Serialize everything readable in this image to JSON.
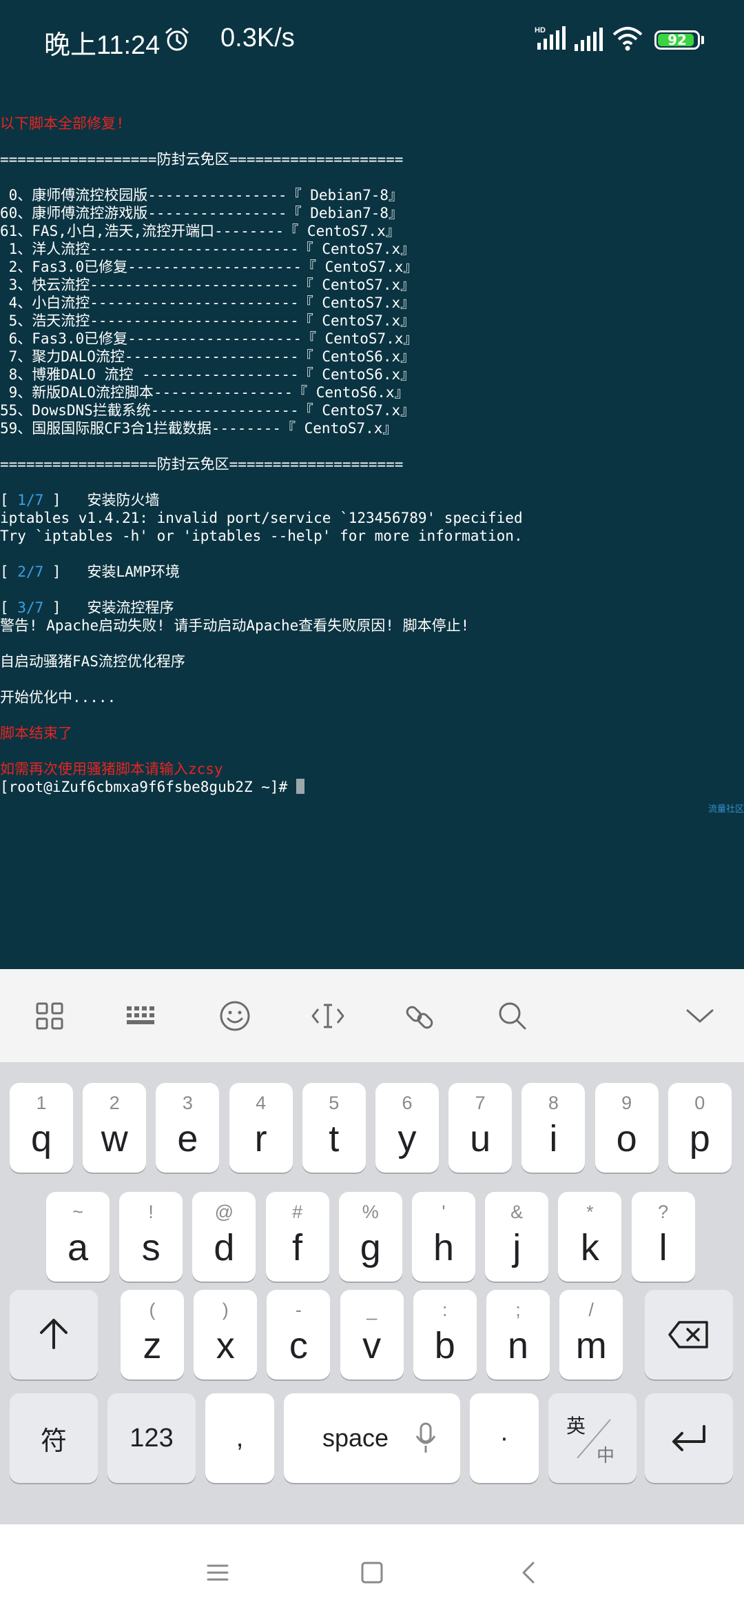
{
  "status_bar": {
    "time": "晚上11:24",
    "net_speed": "0.3K/s",
    "battery": "92",
    "signal_label": "HD",
    "icons": [
      "alarm-icon",
      "signal-icon",
      "wifi-icon",
      "battery-icon"
    ]
  },
  "terminal": {
    "lines": [
      {
        "text": "",
        "color": "white"
      },
      {
        "text": "以下脚本全部修复!",
        "color": "red"
      },
      {
        "text": "",
        "color": "white"
      },
      {
        "text": "==================防封云免区====================",
        "color": "white"
      },
      {
        "text": "",
        "color": "white"
      },
      {
        "text": " 0、康师傅流控校园版----------------『 Debian7-8』",
        "color": "white"
      },
      {
        "text": "60、康师傅流控游戏版----------------『 Debian7-8』",
        "color": "white"
      },
      {
        "text": "61、FAS,小白,浩天,流控开端口--------『 CentoS7.x』",
        "color": "white"
      },
      {
        "text": " 1、洋人流控------------------------『 CentoS7.x』",
        "color": "white"
      },
      {
        "text": " 2、Fas3.0已修复--------------------『 CentoS7.x』",
        "color": "white"
      },
      {
        "text": " 3、快云流控------------------------『 CentoS7.x』",
        "color": "white"
      },
      {
        "text": " 4、小白流控------------------------『 CentoS7.x』",
        "color": "white"
      },
      {
        "text": " 5、浩天流控------------------------『 CentoS7.x』",
        "color": "white"
      },
      {
        "text": " 6、Fas3.0已修复--------------------『 CentoS7.x』",
        "color": "white"
      },
      {
        "text": " 7、聚力DALO流控--------------------『 CentoS6.x』",
        "color": "white"
      },
      {
        "text": " 8、博雅DALO 流控 ------------------『 CentoS6.x』",
        "color": "white"
      },
      {
        "text": " 9、新版DALO流控脚本----------------『 CentoS6.x』",
        "color": "white"
      },
      {
        "text": "55、DowsDNS拦截系统-----------------『 CentoS7.x』",
        "color": "white"
      },
      {
        "text": "59、国服国际服CF3合1拦截数据--------『 CentoS7.x』",
        "color": "white"
      },
      {
        "text": "",
        "color": "white"
      },
      {
        "text": "==================防封云免区====================",
        "color": "white"
      },
      {
        "text": "",
        "color": "white"
      },
      {
        "text": "[ ",
        "color": "white",
        "step": "1/7",
        "after": " ]   安装防火墙"
      },
      {
        "text": "iptables v1.4.21: invalid port/service `123456789' specified",
        "color": "white"
      },
      {
        "text": "Try `iptables -h' or 'iptables --help' for more information.",
        "color": "white"
      },
      {
        "text": "",
        "color": "white"
      },
      {
        "text": "[ ",
        "color": "white",
        "step": "2/7",
        "after": " ]   安装LAMP环境"
      },
      {
        "text": "",
        "color": "white"
      },
      {
        "text": "[ ",
        "color": "white",
        "step": "3/7",
        "after": " ]   安装流控程序"
      },
      {
        "text": "警告! Apache启动失败! 请手动启动Apache查看失败原因! 脚本停止!",
        "color": "white"
      },
      {
        "text": "",
        "color": "white"
      },
      {
        "text": "自启动骚猪FAS流控优化程序",
        "color": "white"
      },
      {
        "text": "",
        "color": "white"
      },
      {
        "text": "开始优化中.....",
        "color": "white"
      },
      {
        "text": "",
        "color": "white"
      },
      {
        "text": "脚本结束了",
        "color": "red"
      },
      {
        "text": "",
        "color": "white"
      },
      {
        "text": "如需再次使用骚猪脚本请输入zcsy",
        "color": "red"
      },
      {
        "text": "[root@iZuf6cbmxa9f6fsbe8gub2Z ~]# ",
        "color": "white",
        "cursor": true
      }
    ],
    "watermark": "流量社区"
  },
  "keyboard": {
    "toolbar_icons": [
      "grid-icon",
      "keyboard-icon",
      "emoji-icon",
      "cursor-move-icon",
      "clipboard-icon",
      "search-icon",
      "collapse-chevron-icon"
    ],
    "row1": [
      {
        "hint": "1",
        "key": "q"
      },
      {
        "hint": "2",
        "key": "w"
      },
      {
        "hint": "3",
        "key": "e"
      },
      {
        "hint": "4",
        "key": "r"
      },
      {
        "hint": "5",
        "key": "t"
      },
      {
        "hint": "6",
        "key": "y"
      },
      {
        "hint": "7",
        "key": "u"
      },
      {
        "hint": "8",
        "key": "i"
      },
      {
        "hint": "9",
        "key": "o"
      },
      {
        "hint": "0",
        "key": "p"
      }
    ],
    "row2": [
      {
        "hint": "~",
        "key": "a"
      },
      {
        "hint": "!",
        "key": "s"
      },
      {
        "hint": "@",
        "key": "d"
      },
      {
        "hint": "#",
        "key": "f"
      },
      {
        "hint": "%",
        "key": "g"
      },
      {
        "hint": "'",
        "key": "h"
      },
      {
        "hint": "&",
        "key": "j"
      },
      {
        "hint": "*",
        "key": "k"
      },
      {
        "hint": "?",
        "key": "l"
      }
    ],
    "row3": [
      {
        "hint": "(",
        "key": "z"
      },
      {
        "hint": ")",
        "key": "x"
      },
      {
        "hint": "-",
        "key": "c"
      },
      {
        "hint": "_",
        "key": "v"
      },
      {
        "hint": ":",
        "key": "b"
      },
      {
        "hint": ";",
        "key": "n"
      },
      {
        "hint": "/",
        "key": "m"
      }
    ],
    "symbols_label": "符",
    "numbers_label": "123",
    "comma_label": ",",
    "space_label": "space",
    "period_label": "·",
    "lang_top": "英",
    "lang_bottom": "中"
  },
  "nav_icons": [
    "menu-icon",
    "home-icon",
    "back-icon"
  ]
}
